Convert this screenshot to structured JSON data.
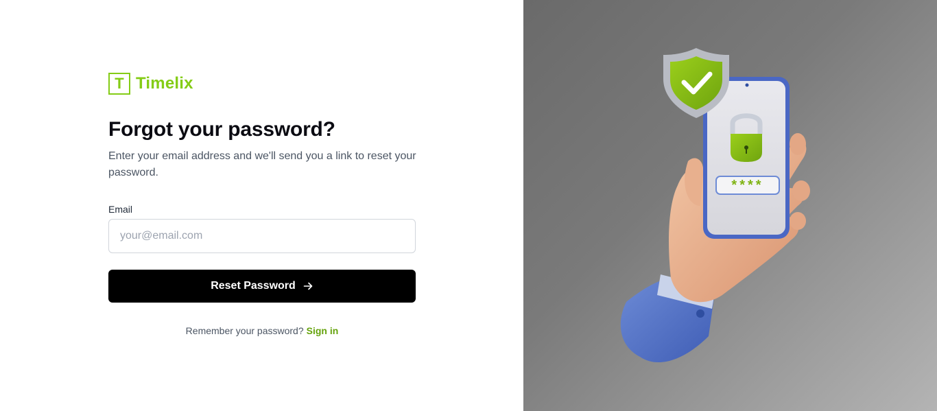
{
  "brand": {
    "mark": "T",
    "name": "Timelix",
    "accent_color": "#84cc16"
  },
  "heading": {
    "title": "Forgot your password?",
    "subtitle": "Enter your email address and we'll send you a link to reset your password."
  },
  "form": {
    "email_label": "Email",
    "email_value": "",
    "email_placeholder": "your@email.com",
    "submit_label": "Reset Password",
    "submit_icon": "arrow-right-icon"
  },
  "footer": {
    "prompt": "Remember your password?",
    "signin_link": "Sign in",
    "link_color": "#65a30d"
  },
  "illustration": {
    "name": "hand-holding-phone-security-illustration",
    "password_mask": "****"
  }
}
